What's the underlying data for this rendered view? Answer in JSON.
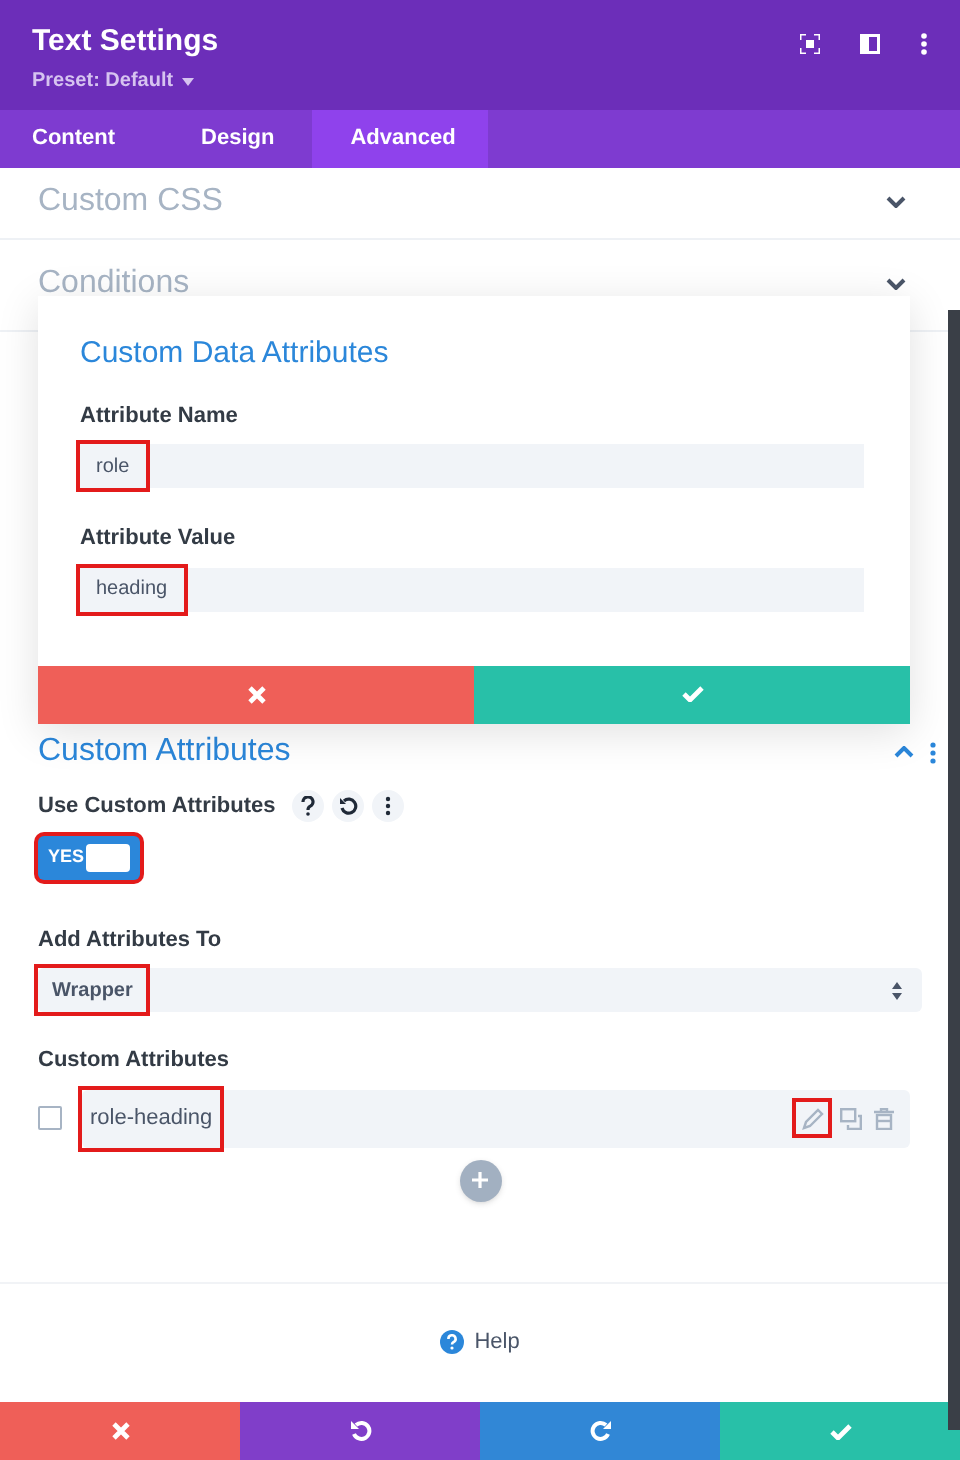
{
  "header": {
    "title": "Text Settings",
    "preset": "Preset: Default"
  },
  "tabs": [
    {
      "label": "Content",
      "selected": false
    },
    {
      "label": "Design",
      "selected": false
    },
    {
      "label": "Advanced",
      "selected": true
    }
  ],
  "collapsed_sections": [
    {
      "title": "Custom CSS",
      "expanded": false
    },
    {
      "title": "Conditions",
      "expanded": false
    }
  ],
  "modal": {
    "title": "Custom Data Attributes",
    "fields": [
      {
        "label": "Attribute Name",
        "value": "role",
        "highlighted": true
      },
      {
        "label": "Attribute Value",
        "value": "heading",
        "highlighted": true
      }
    ]
  },
  "custom_attributes": {
    "title": "Custom Attributes",
    "expanded": true,
    "use_custom": {
      "label": "Use Custom Attributes",
      "toggle_label": "YES",
      "on": true,
      "highlighted": true
    },
    "add_to": {
      "label": "Add Attributes To",
      "value": "Wrapper",
      "highlighted": true
    },
    "list": {
      "label": "Custom Attributes",
      "items": [
        {
          "name": "role-heading",
          "checked": false,
          "highlighted": true,
          "edit_highlighted": true
        }
      ]
    }
  },
  "help": "Help"
}
